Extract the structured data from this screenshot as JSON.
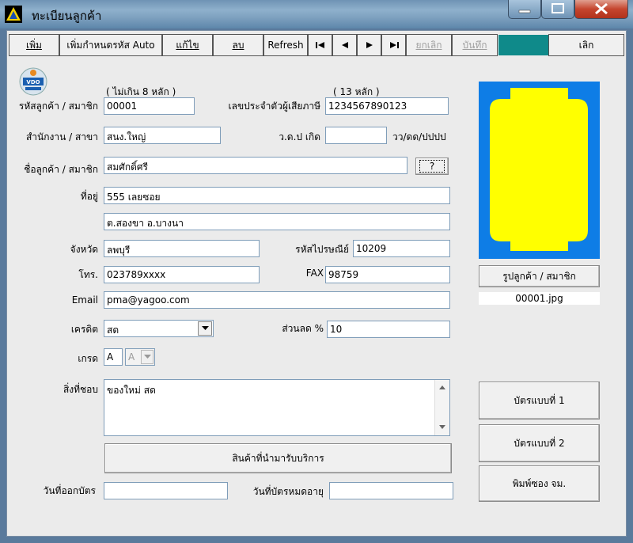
{
  "window": {
    "title": "ทะเบียนลูกค้า"
  },
  "toolbar": {
    "add": "เพิ่ม",
    "add_auto": "เพิ่มกำหนดรหัส Auto",
    "edit": "แก้ไข",
    "delete": "ลบ",
    "refresh": "Refresh",
    "first": "|◀",
    "prev": "◀",
    "next": "▶",
    "last": "▶|",
    "cancel": "ยกเลิก",
    "save": "บันทึก",
    "exit": "เลิก"
  },
  "logo_text": "VDO",
  "form": {
    "code_hint": "( ไม่เกิน 8 หลัก )",
    "tax_hint": "( 13 หลัก )",
    "code_label": "รหัสลูกค้า / สมาชิก",
    "code_value": "00001",
    "tax_label": "เลขประจำตัวผู้เสียภาษี",
    "tax_value": "1234567890123",
    "branch_label": "สำนักงาน / สาขา",
    "branch_value": "สนง.ใหญ่",
    "birth_label": "ว.ด.ป เกิด",
    "birth_value": "",
    "birth_format": "วว/ดด/ปปปป",
    "name_label": "ชื่อลูกค้า / สมาชิก",
    "name_value": "สมศักดิ์ศรี",
    "name_lookup": "?",
    "address_label": "ที่อยู่",
    "address1": "555 เลยซอย",
    "address2": "ต.สองขา  อ.บางนา",
    "province_label": "จังหวัด",
    "province_value": "ลพบุรี",
    "postal_label": "รหัสไปรษณีย์",
    "postal_value": "10209",
    "phone_label": "โทร.",
    "phone_value": "023789xxxx",
    "fax_label": "FAX",
    "fax_value": "98759",
    "email_label": "Email",
    "email_value": "pma@yagoo.com",
    "credit_label": "เครดิต",
    "credit_value": "สด",
    "discount_label": "ส่วนลด %",
    "discount_value": "10",
    "grade_label": "เกรด",
    "grade_value": "A",
    "grade_select": "A",
    "likes_label": "สิ่งที่ชอบ",
    "likes_value": "ของใหม่ สด",
    "services_button": "สินค้าที่นำมารับบริการ",
    "issue_label": "วันที่ออกบัตร",
    "issue_value": "",
    "expire_label": "วันที่บัตรหมดอายุ",
    "expire_value": ""
  },
  "photo": {
    "button": "รูปลูกค้า / สมาชิก",
    "filename": "00001.jpg",
    "background": "#0e7de6",
    "shape_color": "#ffff00"
  },
  "actions": {
    "card1": "บัตรแบบที่ 1",
    "card2": "บัตรแบบที่ 2",
    "print_envelope": "พิมพ์ซอง จม."
  }
}
